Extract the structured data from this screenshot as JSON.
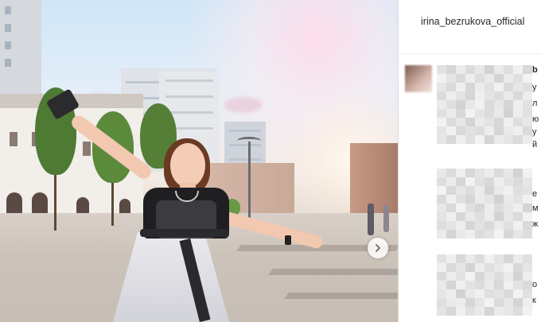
{
  "post": {
    "username": "irina_bezrukova_official",
    "carousel_next_icon": "chevron-right-icon"
  },
  "comments_panel": {
    "first_comment_user_fragment": "b",
    "edge_glyphs": [
      "у",
      "л",
      "ю",
      "у",
      "й",
      "е",
      "м",
      "ж",
      "о",
      "к"
    ]
  },
  "colors": {
    "panel_bg": "#ffffff",
    "divider": "#dbdbdb",
    "text": "#262626"
  }
}
